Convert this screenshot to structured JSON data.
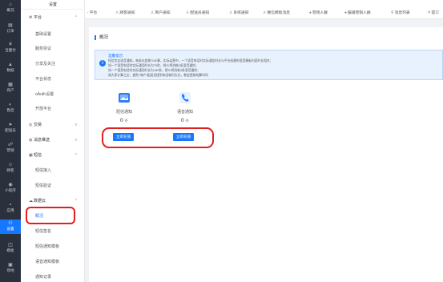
{
  "rail": {
    "items": [
      {
        "icon": "overview-icon",
        "label": "概况"
      },
      {
        "icon": "order-icon",
        "label": "订单"
      },
      {
        "icon": "payment-icon",
        "label": "当面付"
      },
      {
        "icon": "data-icon",
        "label": "数据"
      },
      {
        "icon": "merchant-icon",
        "label": "商户"
      },
      {
        "icon": "ticket-icon",
        "label": "售后"
      },
      {
        "icon": "delivery-icon",
        "label": "配送员"
      },
      {
        "icon": "promo-icon",
        "label": "营销"
      },
      {
        "icon": "customer-icon",
        "label": "顾客"
      },
      {
        "icon": "miniapp-icon",
        "label": "小程序"
      },
      {
        "icon": "apps-icon",
        "label": "应用"
      },
      {
        "icon": "settings-icon",
        "label": "设置"
      },
      {
        "icon": "template-icon",
        "label": "模板"
      },
      {
        "icon": "venue-icon",
        "label": "场地"
      }
    ]
  },
  "side": {
    "header": "设置",
    "groups": [
      {
        "label": "平台",
        "icon": "gear-icon",
        "open": true,
        "items": [
          "基础设置",
          "服务协议",
          "分享及关注",
          "平台状态",
          "oAuth设置",
          "开放平台"
        ]
      },
      {
        "label": "交易",
        "icon": "trade-icon",
        "open": false
      },
      {
        "label": "消息推送",
        "icon": "message-icon",
        "open": false
      },
      {
        "label": "短信",
        "icon": "sms-icon",
        "open": true,
        "items": [
          "短信接入",
          "短信验证"
        ]
      },
      {
        "label": "数据云",
        "icon": "cloud-icon",
        "open": true,
        "items": [
          "概况",
          "短信签名",
          "短信通知模板",
          "语音通知模板",
          "通知记录"
        ]
      }
    ]
  },
  "tabs": [
    {
      "icon": "",
      "label": "平台"
    },
    {
      "icon": "user-icon",
      "label": "顾客通知"
    },
    {
      "icon": "user-icon",
      "label": "商户通知"
    },
    {
      "icon": "user-icon",
      "label": "配送员通知"
    },
    {
      "icon": "user-icon",
      "label": "系统通知"
    },
    {
      "icon": "user-icon",
      "label": "微信模板消息"
    },
    {
      "icon": "dot-icon",
      "label": "营销人群"
    },
    {
      "icon": "dot-icon",
      "label": "编辑营销人群"
    },
    {
      "icon": "dot-icon",
      "label": "消息列表"
    },
    {
      "icon": "dot-icon",
      "label": "提订"
    }
  ],
  "main": {
    "title": "概况",
    "notice": {
      "title": "温馨提示",
      "lines": [
        "短信包含语音通知，每条长度按70计算，实际运营中，一个语音电话时实际通信时长与平台创建的语音模板内容时长相关；",
        "如一个语音电话时实际通话时长为75秒，那么将消耗2条语音通知；",
        "如一个语音电话时实际通话时长为180秒，那么将消耗3条语音通知；",
        "请大家计算之后，避免7商户/配送员接到电话耗时太长，都会提前结算时间"
      ]
    },
    "stats": [
      {
        "icon": "sms-image-icon",
        "label": "短信通知",
        "value": "0",
        "unit": "条",
        "button": "立即充值"
      },
      {
        "icon": "phone-icon",
        "label": "语音通知",
        "value": "0",
        "unit": "条",
        "button": "立即充值"
      }
    ]
  },
  "colors": {
    "accent": "#1677ff",
    "rail": "#2b313c",
    "highlight": "#e02020"
  }
}
